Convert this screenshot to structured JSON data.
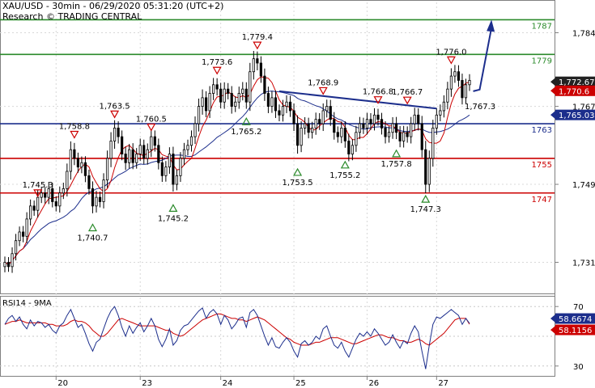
{
  "header": {
    "title": "XAU/USD - 30min - 06/29/2020 05:31:20 (UTC+2)",
    "credit": "Research © TRADING CENTRAL"
  },
  "rsi_label": "RSI14 - 9MA",
  "colors": {
    "candle": "#000000",
    "ma_fast": "#cc0000",
    "ma_slow": "#1c2e8c",
    "resistance": "#2a8a2a",
    "pivot": "#1c2e8c",
    "support": "#cc0000",
    "last_price": "#222222",
    "rsi": "#1c2e8c",
    "rsi_ma": "#cc0000"
  },
  "chart_data": [
    {
      "type": "line",
      "subtype": "candlestick",
      "x_tick_labels": [
        "20",
        "23",
        "24",
        "25",
        "26",
        "27"
      ],
      "y_tick_labels": [
        "1,784",
        "1,767",
        "1,749",
        "1,731"
      ],
      "ylim": [
        1724,
        1791
      ],
      "levels": [
        {
          "name": "1787",
          "value": 1787,
          "role": "resistance",
          "tag": "1787"
        },
        {
          "name": "1779",
          "value": 1779,
          "role": "resistance",
          "tag": "1779"
        },
        {
          "name": "1763",
          "value": 1763,
          "role": "pivot",
          "tag": "1763"
        },
        {
          "name": "1755",
          "value": 1755,
          "role": "support",
          "tag": "1755"
        },
        {
          "name": "1747",
          "value": 1747,
          "role": "support",
          "tag": "1747"
        }
      ],
      "price_badges": [
        {
          "label": "1,772.67",
          "value": 1772.67,
          "color": "#222222"
        },
        {
          "label": "1,770.6",
          "value": 1770.6,
          "color": "#cc0000"
        },
        {
          "label": "1,765.03",
          "value": 1765.03,
          "color": "#1c2e8c"
        }
      ],
      "swing_highs": [
        {
          "label": "1,745.3",
          "t": 9,
          "v": 1745.3
        },
        {
          "label": "1,758.8",
          "t": 19,
          "v": 1758.8
        },
        {
          "label": "1,763.5",
          "t": 30,
          "v": 1763.5
        },
        {
          "label": "1,760.5",
          "t": 40,
          "v": 1760.5
        },
        {
          "label": "1,773.6",
          "t": 58,
          "v": 1773.6
        },
        {
          "label": "1,779.4",
          "t": 69,
          "v": 1779.4
        },
        {
          "label": "1,768.9",
          "t": 87,
          "v": 1768.9
        },
        {
          "label": "1,766.8",
          "t": 102,
          "v": 1766.8
        },
        {
          "label": "1,766.7",
          "t": 110,
          "v": 1766.7
        },
        {
          "label": "1,776.0",
          "t": 122,
          "v": 1776.0
        }
      ],
      "swing_lows": [
        {
          "label": "1,740.7",
          "t": 24,
          "v": 1740.7
        },
        {
          "label": "1,745.2",
          "t": 46,
          "v": 1745.2
        },
        {
          "label": "1,765.2",
          "t": 66,
          "v": 1765.2
        },
        {
          "label": "1,753.5",
          "t": 80,
          "v": 1753.5
        },
        {
          "label": "1,755.2",
          "t": 93,
          "v": 1755.2
        },
        {
          "label": "1,757.8",
          "t": 107,
          "v": 1757.8
        },
        {
          "label": "1,747.3",
          "t": 115,
          "v": 1747.3
        }
      ],
      "annotations": [
        "1,767.3"
      ],
      "trendline": [
        {
          "t": 75,
          "v": 1770.5
        },
        {
          "t": 118,
          "v": 1766.5
        }
      ],
      "forecast_arrow": [
        {
          "t": 128,
          "v": 1770.5
        },
        {
          "t": 133,
          "v": 1787
        }
      ],
      "close": [
        1731,
        1730,
        1733,
        1736,
        1738,
        1737,
        1741,
        1744,
        1743,
        1746,
        1747,
        1746,
        1748,
        1745,
        1744,
        1747,
        1748,
        1752,
        1757,
        1755,
        1753,
        1754,
        1751,
        1748,
        1744,
        1746,
        1745,
        1750,
        1755,
        1759,
        1762,
        1760,
        1756,
        1754,
        1757,
        1754,
        1756,
        1758,
        1755,
        1757,
        1760,
        1758,
        1754,
        1751,
        1753,
        1756,
        1749,
        1751,
        1755,
        1757,
        1758,
        1760,
        1763,
        1767,
        1769,
        1766,
        1770,
        1772,
        1771,
        1768,
        1771,
        1770,
        1767,
        1768,
        1770,
        1771,
        1768,
        1775,
        1778,
        1777,
        1774,
        1770,
        1767,
        1769,
        1766,
        1765,
        1767,
        1768,
        1766,
        1763,
        1758,
        1762,
        1763,
        1761,
        1762,
        1764,
        1763,
        1766,
        1767,
        1764,
        1761,
        1760,
        1762,
        1759,
        1756,
        1758,
        1761,
        1763,
        1762,
        1764,
        1763,
        1765,
        1764,
        1762,
        1760,
        1761,
        1763,
        1761,
        1759,
        1761,
        1760,
        1763,
        1765,
        1763,
        1757,
        1749,
        1755,
        1762,
        1765,
        1766,
        1768,
        1771,
        1774,
        1775,
        1773,
        1769,
        1772,
        1773
      ],
      "high_low_spread": [
        2.2,
        2.0,
        2.4,
        2.6,
        2.1,
        2.3,
        2.6,
        2.5,
        2.1,
        2.8,
        2.2,
        2.4,
        2.6,
        2.2,
        2.1,
        2.5,
        2.3,
        3.0,
        3.2,
        2.6,
        2.2,
        2.4,
        2.5,
        2.3,
        2.8,
        2.5,
        2.2,
        2.6,
        3.0,
        3.4,
        3.0,
        2.6,
        2.4,
        2.8,
        2.2,
        2.5,
        2.3,
        2.6,
        2.2,
        2.4,
        2.8,
        2.4,
        2.6,
        2.4,
        2.3,
        2.6,
        2.8,
        2.3,
        2.4,
        2.6,
        2.2,
        2.4,
        2.8,
        3.0,
        3.2,
        2.5,
        2.8,
        2.6,
        2.5,
        2.4,
        2.6,
        2.3,
        2.8,
        2.2,
        2.6,
        2.7,
        2.6,
        3.4,
        3.0,
        2.8,
        2.6,
        2.9,
        2.6,
        2.5,
        2.8,
        2.4,
        2.5,
        2.6,
        2.4,
        2.8,
        3.2,
        2.6,
        2.5,
        2.3,
        2.4,
        2.6,
        2.4,
        2.8,
        2.6,
        2.5,
        2.8,
        2.3,
        2.5,
        2.6,
        2.8,
        2.4,
        2.5,
        2.6,
        2.3,
        2.5,
        2.4,
        2.6,
        2.4,
        2.5,
        2.6,
        2.3,
        2.5,
        2.6,
        2.4,
        2.5,
        2.3,
        2.6,
        2.8,
        2.6,
        3.0,
        3.4,
        3.0,
        3.2,
        2.6,
        2.4,
        2.6,
        2.8,
        3.0,
        2.6,
        2.5,
        2.6,
        2.3,
        2.4
      ]
    },
    {
      "type": "line",
      "title": "RSI14 - 9MA",
      "y_tick_labels": [
        "70",
        "30"
      ],
      "ylim": [
        25,
        75
      ],
      "guides": [
        70,
        50,
        30
      ],
      "value_badges": [
        {
          "label": "58.6674",
          "value": 58.6674,
          "color": "#1c2e8c"
        },
        {
          "label": "58.1156",
          "value": 58.1156,
          "color": "#cc0000"
        }
      ],
      "series": [
        {
          "values": [
            58,
            62,
            64,
            60,
            63,
            58,
            55,
            61,
            57,
            60,
            59,
            56,
            58,
            54,
            52,
            57,
            59,
            64,
            68,
            62,
            56,
            58,
            52,
            45,
            40,
            46,
            48,
            55,
            62,
            67,
            70,
            64,
            56,
            50,
            57,
            52,
            56,
            59,
            53,
            57,
            62,
            57,
            48,
            43,
            48,
            55,
            44,
            47,
            54,
            57,
            58,
            61,
            64,
            67,
            69,
            62,
            66,
            68,
            65,
            58,
            64,
            61,
            55,
            58,
            62,
            63,
            56,
            66,
            68,
            64,
            57,
            50,
            44,
            49,
            43,
            42,
            46,
            49,
            46,
            40,
            36,
            45,
            47,
            44,
            46,
            50,
            48,
            55,
            57,
            50,
            44,
            42,
            46,
            40,
            36,
            42,
            48,
            52,
            50,
            53,
            50,
            55,
            52,
            48,
            44,
            46,
            51,
            46,
            42,
            47,
            45,
            52,
            57,
            53,
            40,
            28,
            44,
            58,
            63,
            62,
            64,
            66,
            68,
            66,
            64,
            58,
            62,
            58.7
          ]
        },
        {
          "values": [
            58,
            59,
            60,
            60,
            61,
            60,
            59,
            59,
            59,
            59,
            59,
            59,
            58,
            58,
            57,
            57,
            57,
            58,
            60,
            61,
            60,
            60,
            59,
            57,
            54,
            52,
            50,
            50,
            52,
            55,
            58,
            61,
            62,
            61,
            60,
            59,
            58,
            57,
            57,
            57,
            57,
            57,
            56,
            55,
            54,
            54,
            52,
            51,
            50,
            51,
            53,
            55,
            57,
            59,
            61,
            62,
            63,
            64,
            65,
            65,
            64,
            63,
            62,
            62,
            61,
            61,
            60,
            61,
            62,
            63,
            62,
            61,
            59,
            57,
            55,
            53,
            51,
            49,
            48,
            46,
            45,
            44,
            44,
            44,
            45,
            46,
            46,
            47,
            48,
            49,
            49,
            49,
            48,
            47,
            46,
            45,
            45,
            46,
            47,
            48,
            49,
            50,
            51,
            51,
            50,
            49,
            49,
            48,
            47,
            47,
            46,
            46,
            47,
            48,
            47,
            45,
            44,
            46,
            48,
            50,
            52,
            55,
            58,
            61,
            62,
            62,
            62,
            58.1
          ]
        }
      ]
    }
  ]
}
